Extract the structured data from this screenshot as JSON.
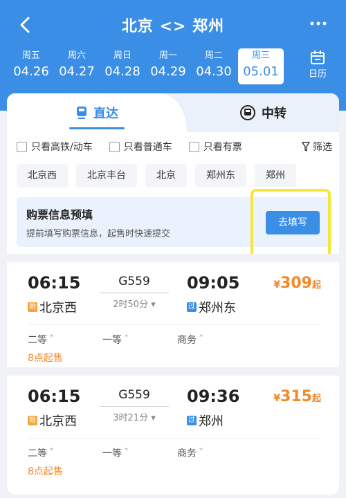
{
  "header": {
    "title": "北京 <> 郑州",
    "calendar_label": "日历"
  },
  "dates": [
    {
      "weekday": "周五",
      "date": "04.26",
      "active": false
    },
    {
      "weekday": "周六",
      "date": "04.27",
      "active": false
    },
    {
      "weekday": "周日",
      "date": "04.28",
      "active": false
    },
    {
      "weekday": "周一",
      "date": "04.29",
      "active": false
    },
    {
      "weekday": "周二",
      "date": "04.30",
      "active": false
    },
    {
      "weekday": "周三",
      "date": "05.01",
      "active": true
    }
  ],
  "tabs": {
    "direct": "直达",
    "transfer": "中转"
  },
  "filters": {
    "high_speed": "只看高铁/动车",
    "normal": "只看普通车",
    "available": "只看有票",
    "screen": "筛选"
  },
  "stations": [
    "北京西",
    "北京丰台",
    "北京",
    "郑州东",
    "郑州"
  ],
  "prefill": {
    "title": "购票信息预填",
    "subtitle": "提前填写购票信息，起售时快速提交",
    "button": "去填写"
  },
  "trains": [
    {
      "dep_time": "06:15",
      "train_no": "G559",
      "duration": "2时50分 ▾",
      "arr_time": "09:05",
      "dep_badge": "始",
      "dep_station": "北京西",
      "arr_badge": "过",
      "arr_station": "郑州东",
      "currency": "¥",
      "price": "309",
      "price_suffix": "起",
      "seat1": "二等",
      "seat2": "一等",
      "seat3": "商务",
      "sale": "8点起售"
    },
    {
      "dep_time": "06:15",
      "train_no": "G559",
      "duration": "3时21分 ▾",
      "arr_time": "09:36",
      "dep_badge": "始",
      "dep_station": "北京西",
      "arr_badge": "过",
      "arr_station": "郑州",
      "currency": "¥",
      "price": "315",
      "price_suffix": "起",
      "seat1": "二等",
      "seat2": "一等",
      "seat3": "商务",
      "sale": "8点起售"
    }
  ],
  "colors": {
    "brand": "#3a8ee6",
    "price": "#f28a2a",
    "highlight": "#f5e63a"
  }
}
